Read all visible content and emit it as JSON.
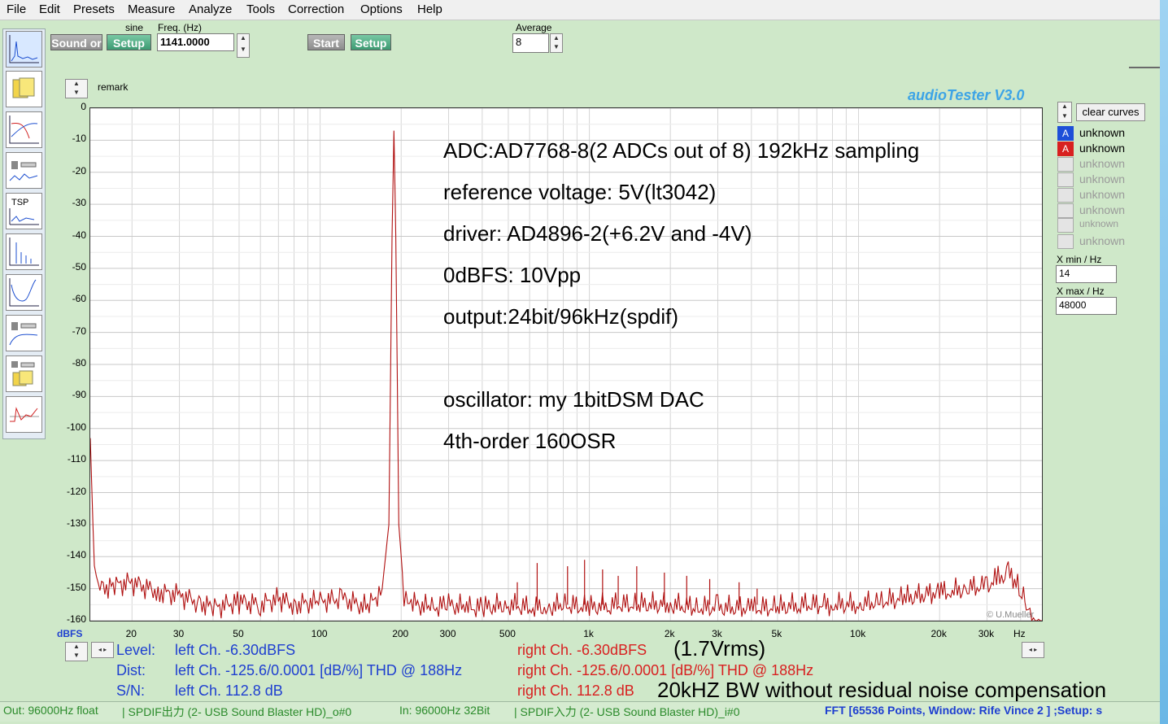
{
  "menu": [
    "File",
    "Edit",
    "Presets",
    "Measure",
    "Analyze",
    "Tools",
    "Correction",
    "Options",
    "Help"
  ],
  "generator": {
    "sound_label": "Sound or",
    "setup_label": "Setup",
    "wave_label": "sine",
    "freq_label": "Freq. (Hz)",
    "freq_value": "1141.0000",
    "start_label": "Start",
    "setup2_label": "Setup",
    "average_label": "Average",
    "average_value": "8"
  },
  "plot": {
    "remark_label": "remark",
    "brand": "audioTester  V3.0",
    "copyright": "© U.Mueller",
    "y_unit": "dBFS",
    "x_unit": "Hz"
  },
  "annotation": [
    "ADC:AD7768-8(2 ADCs out of 8)  192kHz sampling",
    "reference voltage: 5V(lt3042)",
    "driver: AD4896-2(+6.2V and -4V)",
    "0dBFS: 10Vpp",
    "output:24bit/96kHz(spdif)",
    "oscillator: my 1bitDSM DAC",
    "4th-order 160OSR"
  ],
  "side": {
    "clear_label": "clear curves",
    "channels": [
      {
        "badge": "A",
        "label": "unknown",
        "color": "#1e4fd8"
      },
      {
        "badge": "A",
        "label": "unknown",
        "color": "#d82020"
      },
      {
        "badge": "",
        "label": "unknown",
        "color": ""
      },
      {
        "badge": "",
        "label": "unknown",
        "color": ""
      },
      {
        "badge": "",
        "label": "unknown",
        "color": ""
      },
      {
        "badge": "",
        "label": "unknown",
        "color": ""
      },
      {
        "badge": "",
        "label": "unknown",
        "color": ""
      },
      {
        "badge": "",
        "label": "unknown",
        "color": ""
      }
    ],
    "xmin_label": "X min / Hz",
    "xmin_value": "14",
    "xmax_label": "X max / Hz",
    "xmax_value": "48000"
  },
  "results": {
    "level_label": "Level:",
    "dist_label": "Dist:",
    "sn_label": "S/N:",
    "left_level": "left Ch. -6.30dBFS",
    "left_dist": "left Ch. -125.6/0.0001 [dB/%] THD @ 188Hz",
    "left_sn": "left Ch. 112.8 dB",
    "right_level": "right Ch. -6.30dBFS",
    "right_dist": "right Ch. -125.6/0.0001 [dB/%] THD @ 188Hz",
    "right_sn": "right Ch. 112.8 dB",
    "note_vrms": "(1.7Vrms)",
    "note_bw": "20kHZ BW without residual noise compensation"
  },
  "status": {
    "out": "Out: 96000Hz float",
    "out_dev": "| SPDIF出力 (2- USB Sound Blaster HD)_o#0",
    "in": "In: 96000Hz 32Bit",
    "in_dev": "| SPDIF入力 (2- USB Sound Blaster HD)_i#0",
    "fft": "FFT [65536 Points, Window: Rife Vince 2 ]  ;Setup: s"
  },
  "colors": {
    "left": "#1e3fd0",
    "right": "#d82020",
    "trace": "#b01010",
    "accent": "#3da4e6"
  },
  "chart_data": {
    "type": "line",
    "title": "",
    "xlabel": "Hz",
    "ylabel": "dBFS",
    "xscale": "log",
    "xlim": [
      14,
      48000
    ],
    "ylim": [
      -160,
      0
    ],
    "grid": true,
    "x_ticks": [
      20,
      30,
      50,
      100,
      200,
      300,
      500,
      1000,
      2000,
      3000,
      5000,
      10000,
      20000,
      30000
    ],
    "x_tick_labels": [
      "20",
      "30",
      "50",
      "100",
      "200",
      "300",
      "500",
      "1k",
      "2k",
      "3k",
      "5k",
      "10k",
      "20k",
      "30k"
    ],
    "y_ticks": [
      0,
      -10,
      -20,
      -30,
      -40,
      -50,
      -60,
      -70,
      -80,
      -90,
      -100,
      -110,
      -120,
      -130,
      -140,
      -150,
      -160
    ],
    "series": [
      {
        "x": [
          14,
          14.5,
          15,
          17,
          20,
          25,
          30,
          35,
          40,
          50,
          60,
          70,
          80,
          100,
          120,
          150,
          170,
          180,
          185,
          188,
          191,
          196,
          205,
          215,
          230,
          260,
          300,
          350,
          400,
          500,
          600,
          700,
          800,
          1000,
          1200,
          1500,
          2000,
          2500,
          3000,
          4000,
          5000,
          6000,
          8000,
          10000,
          12000,
          15000,
          20000,
          22000,
          25000,
          30000,
          33000,
          36000,
          38000,
          40000,
          42000,
          44000,
          46000,
          48000
        ],
        "y": [
          -103,
          -145,
          -150,
          -149,
          -148,
          -151,
          -152,
          -154,
          -156,
          -154,
          -155,
          -153,
          -155,
          -154,
          -153,
          -156,
          -150,
          -130,
          -40,
          -7,
          -40,
          -130,
          -152,
          -153,
          -155,
          -156,
          -155,
          -156,
          -156,
          -155,
          -156,
          -156,
          -155,
          -156,
          -155,
          -155,
          -155,
          -156,
          -156,
          -156,
          -156,
          -155,
          -155,
          -155,
          -154,
          -153,
          -151,
          -151,
          -150,
          -149,
          -147,
          -145,
          -148,
          -151,
          -154,
          -158,
          -162,
          -162
        ]
      }
    ],
    "spurs": [
      {
        "x": 540,
        "y": -148
      },
      {
        "x": 640,
        "y": -142
      },
      {
        "x": 830,
        "y": -143
      },
      {
        "x": 960,
        "y": -141
      },
      {
        "x": 1120,
        "y": -144
      },
      {
        "x": 1280,
        "y": -146
      },
      {
        "x": 1500,
        "y": -143
      },
      {
        "x": 1900,
        "y": -145
      },
      {
        "x": 2300,
        "y": -146
      },
      {
        "x": 2800,
        "y": -147
      },
      {
        "x": 3600,
        "y": -148
      },
      {
        "x": 4200,
        "y": -150
      }
    ]
  }
}
